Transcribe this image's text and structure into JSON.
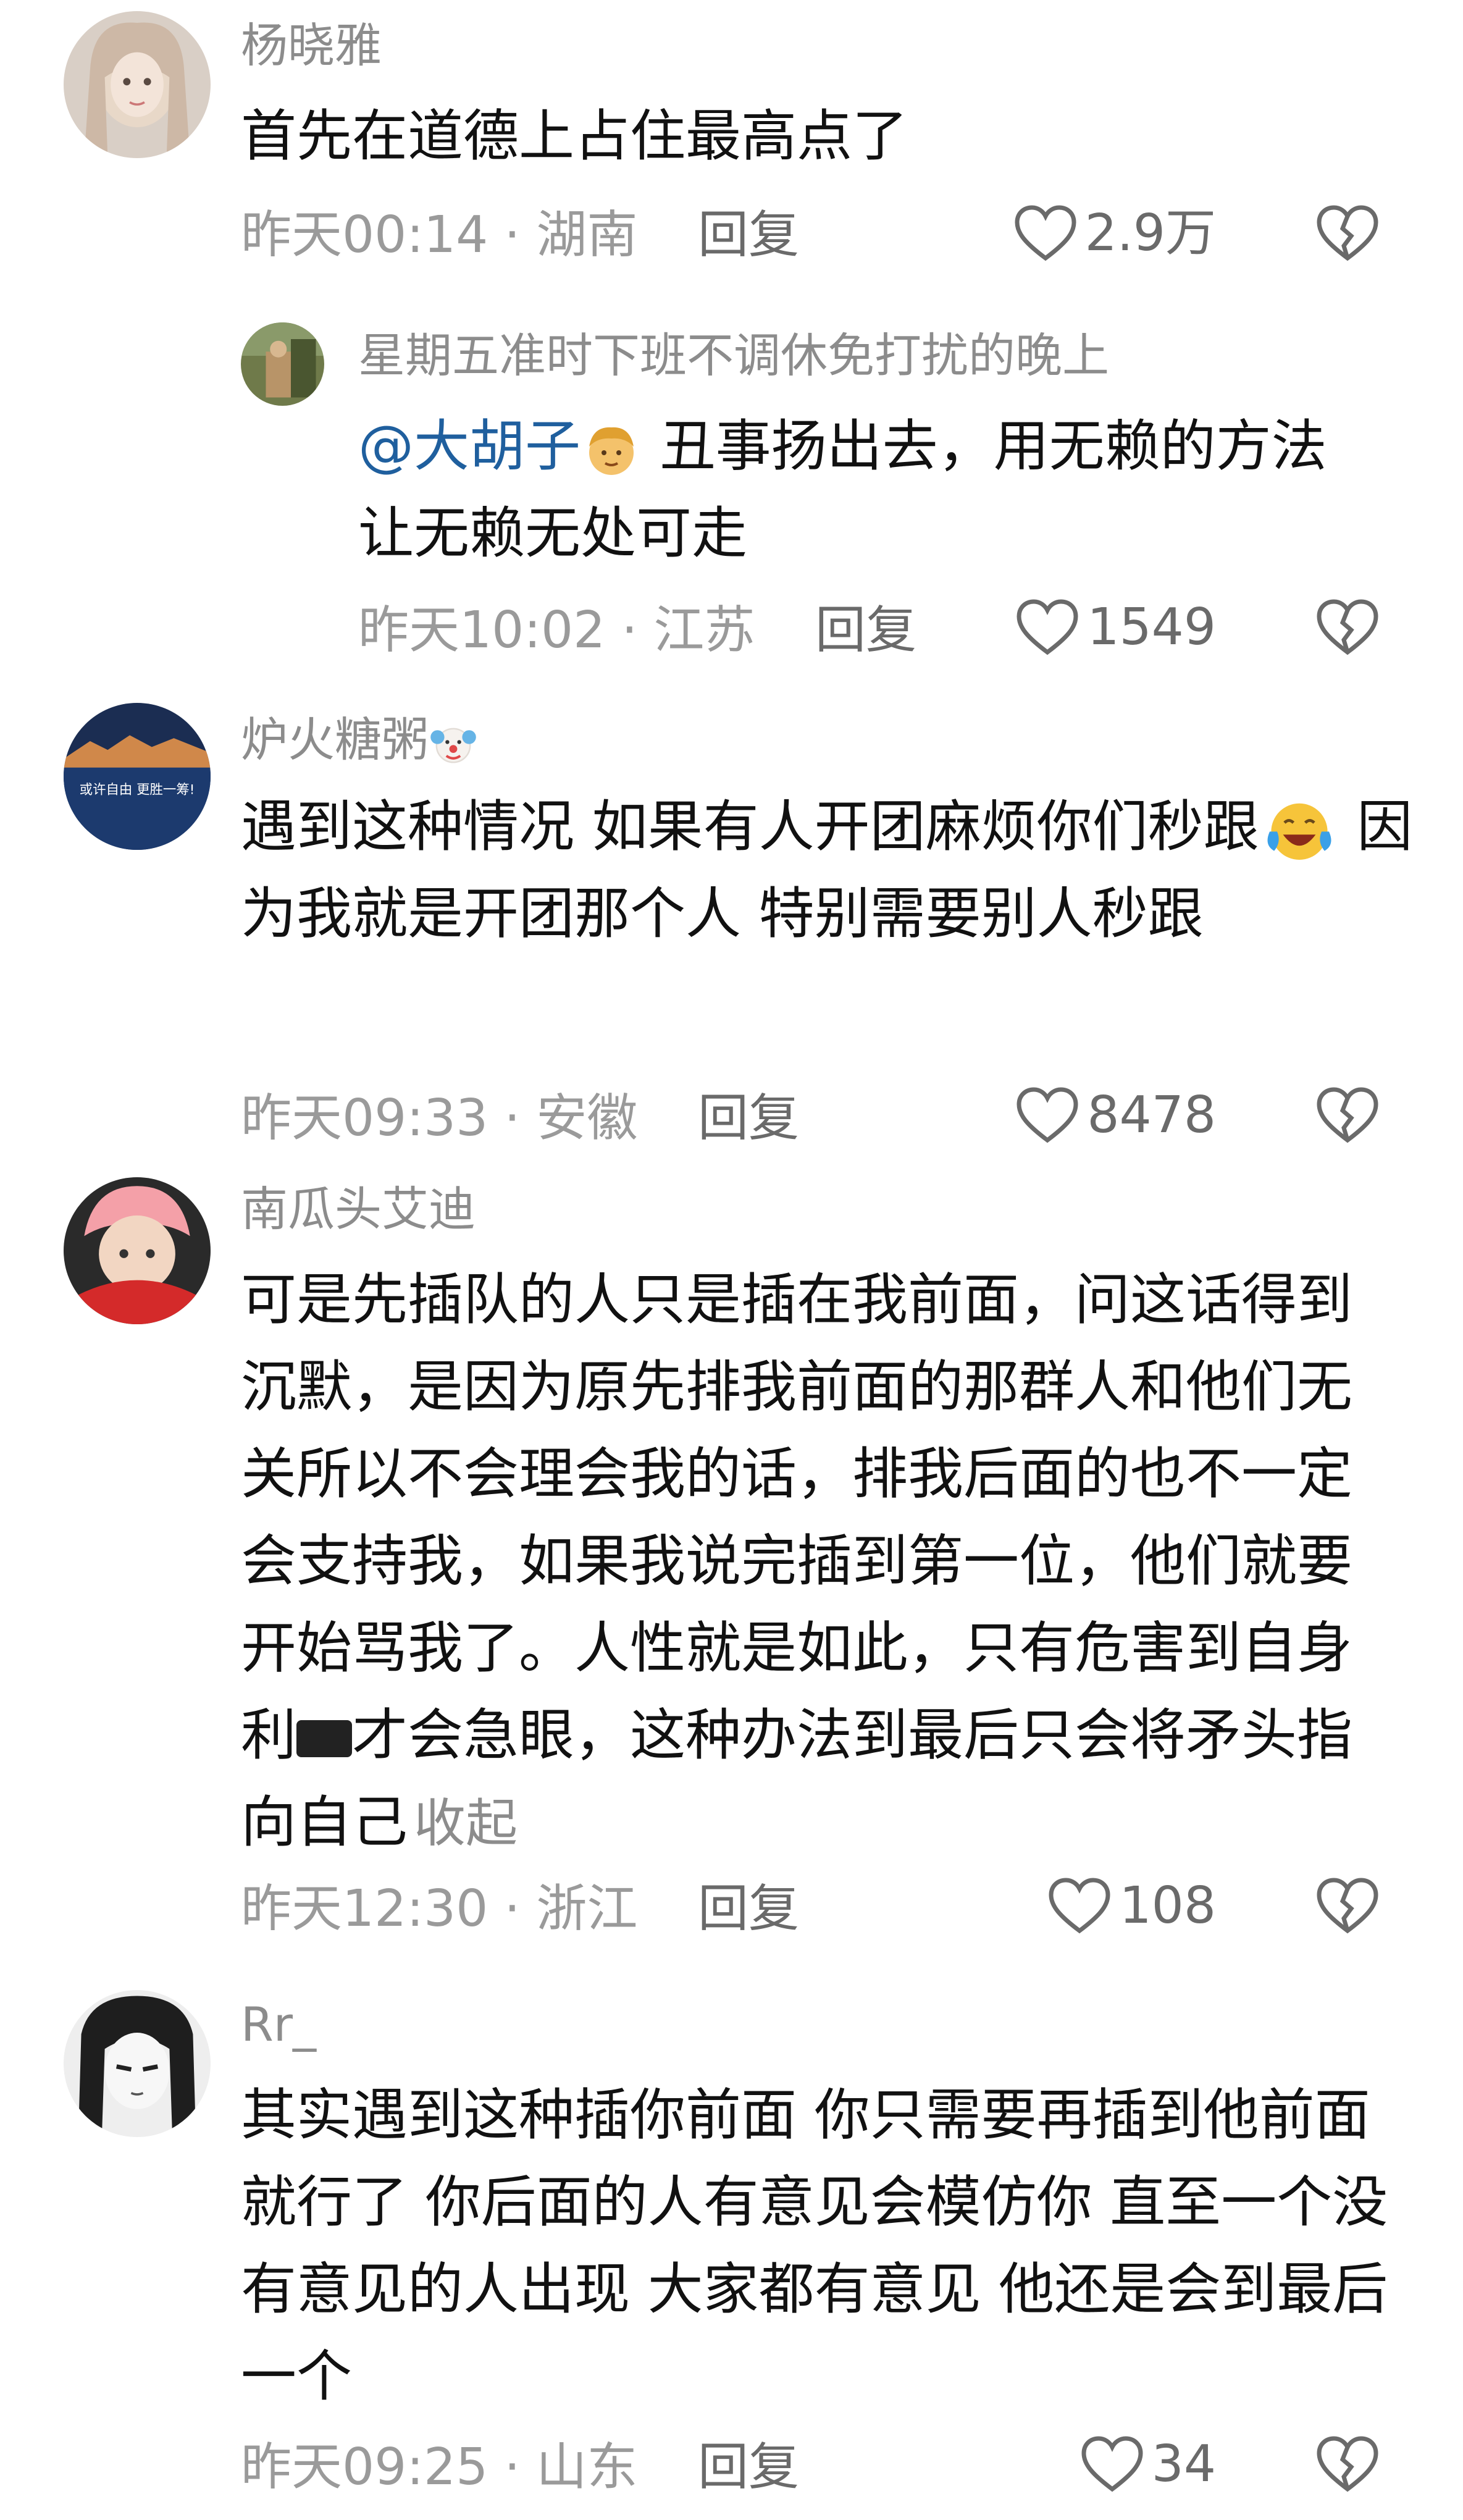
{
  "comments": [
    {
      "username": "杨晓雅",
      "text": "首先在道德上占住最高点了",
      "time": "昨天00:14",
      "location": "湖南",
      "reply": "回复",
      "likes": "2.9万"
    },
    {
      "username": "星期五准时下班不调休免打扰的晚上",
      "mention": "@大胡子",
      "text": " 丑事扬出去，用无赖的方法让无赖无处可走",
      "time": "昨天10:02",
      "location": "江苏",
      "reply": "回复",
      "likes": "1549"
    },
    {
      "username": "炉火糖粥",
      "text_a": "遇到这种情况 如果有人开团麻烦你们秒跟",
      "text_b": " 因为我就是开团那个人 特别需要别人秒跟",
      "avatar_text": "或许自由 更胜一筹!",
      "time": "昨天09:33",
      "location": "安徽",
      "reply": "回复",
      "likes": "8478"
    },
    {
      "username": "南瓜头艾迪",
      "text_a": "可是先插队的人只是插在我前面，问这话得到沉默，是因为原先排我前面的那群人和他们无关所以不会理会我的话，排我后面的也不一定会支持我，如果我说完插到第一位，他们就要开始骂我了。人性就是如此，只有危害到自身利",
      "text_b": "才会急眼，这种办法到最后只会将矛头指向自己",
      "collapse": "收起",
      "time": "昨天12:30",
      "location": "浙江",
      "reply": "回复",
      "likes": "108"
    },
    {
      "username": "Rr_",
      "text": "其实遇到这种插你前面 你只需要再插到他前面就行了 你后面的人有意见会模仿你 直至一个没有意见的人出现 大家都有意见 他还是会到最后一个",
      "time": "昨天09:25",
      "location": "山东",
      "reply": "回复",
      "likes": "34"
    }
  ],
  "meta_separator": "·",
  "icons": {
    "like": "heart-outline-icon",
    "dislike": "broken-heart-icon"
  },
  "colors": {
    "text": "#111111",
    "muted": "#8c8c8c",
    "mention": "#1f5f9e"
  }
}
